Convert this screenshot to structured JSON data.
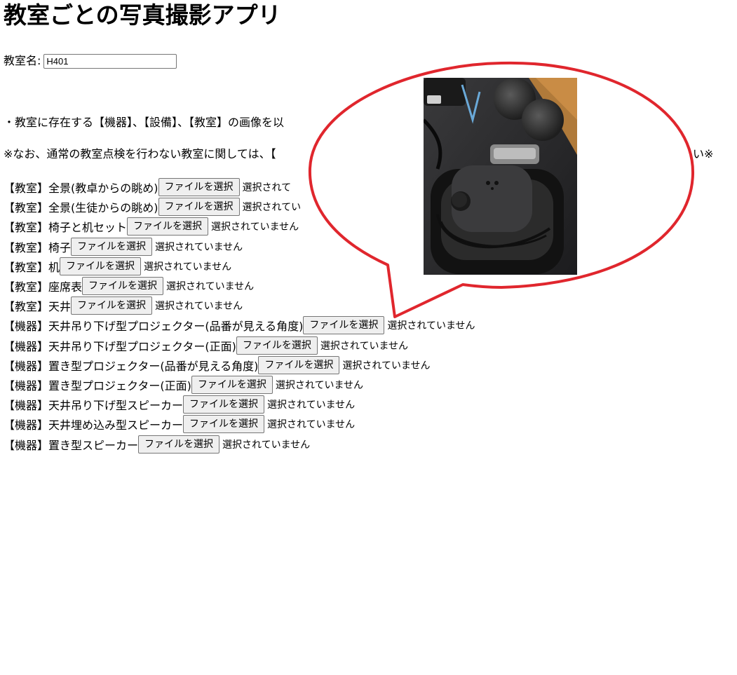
{
  "app": {
    "title": "教室ごとの写真撮影アプリ"
  },
  "room": {
    "label": "教室名:",
    "value": "H401"
  },
  "notes": {
    "line1": "・教室に存在する【機器】、【設備】、【教室】の画像を以",
    "line2": "※なお、通常の教室点検を行わない教室に関しては、【",
    "line2_end": "い※"
  },
  "file_button_label": "ファイルを選択",
  "no_file_text": "選択されていません",
  "items": [
    {
      "label": "【教室】全景(教卓からの眺め)",
      "status": "選択されて"
    },
    {
      "label": "【教室】全景(生徒からの眺め)",
      "status": "選択されてい"
    },
    {
      "label": "【教室】椅子と机セット",
      "status": "選択されていません"
    },
    {
      "label": "【教室】椅子",
      "status": "選択されていません"
    },
    {
      "label": "【教室】机",
      "status": "選択されていません"
    },
    {
      "label": "【教室】座席表",
      "status": "選択されていません"
    },
    {
      "label": "【教室】天井",
      "status": "選択されていません"
    },
    {
      "label": "【機器】天井吊り下げ型プロジェクター(品番が見える角度)",
      "status": "選択されていません"
    },
    {
      "label": "【機器】天井吊り下げ型プロジェクター(正面)",
      "status": "選択されていません"
    },
    {
      "label": "【機器】置き型プロジェクター(品番が見える角度)",
      "status": "選択されていません"
    },
    {
      "label": "【機器】置き型プロジェクター(正面)",
      "status": "選択されていません"
    },
    {
      "label": "【機器】天井吊り下げ型スピーカー",
      "status": "選択されていません"
    },
    {
      "label": "【機器】天井埋め込み型スピーカー",
      "status": "選択されていません"
    },
    {
      "label": "【機器】置き型スピーカー",
      "status": "選択されていません"
    }
  ],
  "callout": {
    "stroke_color": "#e0262d",
    "photo_subject": "wireless-microphone-in-charging-dock"
  }
}
